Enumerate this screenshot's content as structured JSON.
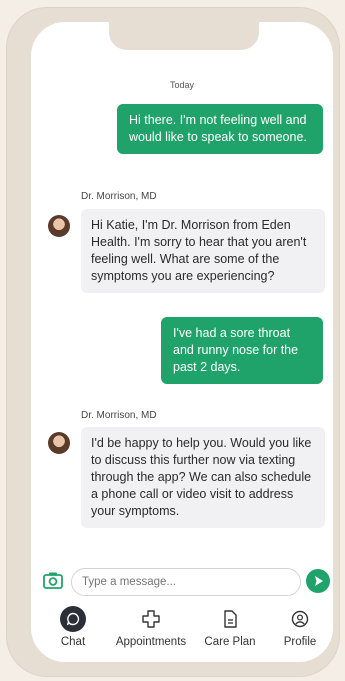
{
  "chat": {
    "day_label": "Today",
    "messages": [
      {
        "direction": "out",
        "text": "Hi there. I'm not feeling well and would like to speak to someone."
      },
      {
        "direction": "in",
        "sender": "Dr. Morrison, MD",
        "text": "Hi Katie, I'm Dr. Morrison from Eden Health. I'm sorry to hear that you aren't feeling well. What are some of the symptoms you are experiencing?"
      },
      {
        "direction": "out",
        "text": "I've had a sore throat and runny nose for the past 2 days."
      },
      {
        "direction": "in",
        "sender": "Dr. Morrison, MD",
        "text": "I'd be happy to help you. Would you like to discuss this further now via texting through the app? We can also schedule a phone call or video visit to address your symptoms."
      }
    ]
  },
  "composer": {
    "placeholder": "Type a message..."
  },
  "tabs": [
    {
      "label": "Chat",
      "icon": "chat-icon",
      "active": true
    },
    {
      "label": "Appointments",
      "icon": "plus-cross-icon"
    },
    {
      "label": "Care Plan",
      "icon": "document-icon"
    },
    {
      "label": "Profile",
      "icon": "profile-icon"
    }
  ],
  "colors": {
    "accent": "#1fa36a",
    "incoming_bubble": "#f1f1f4",
    "frame": "#e6ded3"
  }
}
